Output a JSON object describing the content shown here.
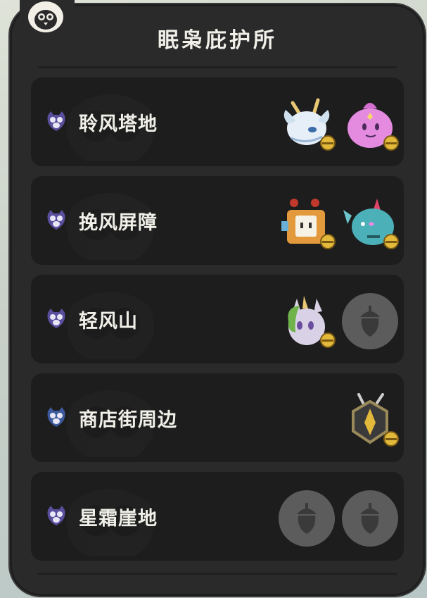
{
  "header": {
    "title": "眠枭庇护所"
  },
  "locations": [
    {
      "label": "聆风塔地",
      "slots": [
        "white-dragon-creature-icon",
        "pink-blob-creature-icon"
      ]
    },
    {
      "label": "挽风屏障",
      "slots": [
        "robot-box-creature-icon",
        "teal-fish-creature-icon"
      ]
    },
    {
      "label": "轻风山",
      "slots": [
        "green-maned-unicorn-creature-icon",
        "empty-acorn-slot-icon"
      ]
    },
    {
      "label": "商店街周边",
      "slots": [
        "armored-beetle-creature-icon"
      ]
    },
    {
      "label": "星霜崖地",
      "slots": [
        "empty-acorn-slot-icon",
        "empty-acorn-slot-icon"
      ]
    }
  ],
  "colors": {
    "panel": "#2a2a2b",
    "row": "#1d1d1e",
    "text": "#f0efe8",
    "empty_slot": "#5c5c5c",
    "bell": "#e3b93c",
    "owl_icon": "#5a4f9e"
  }
}
